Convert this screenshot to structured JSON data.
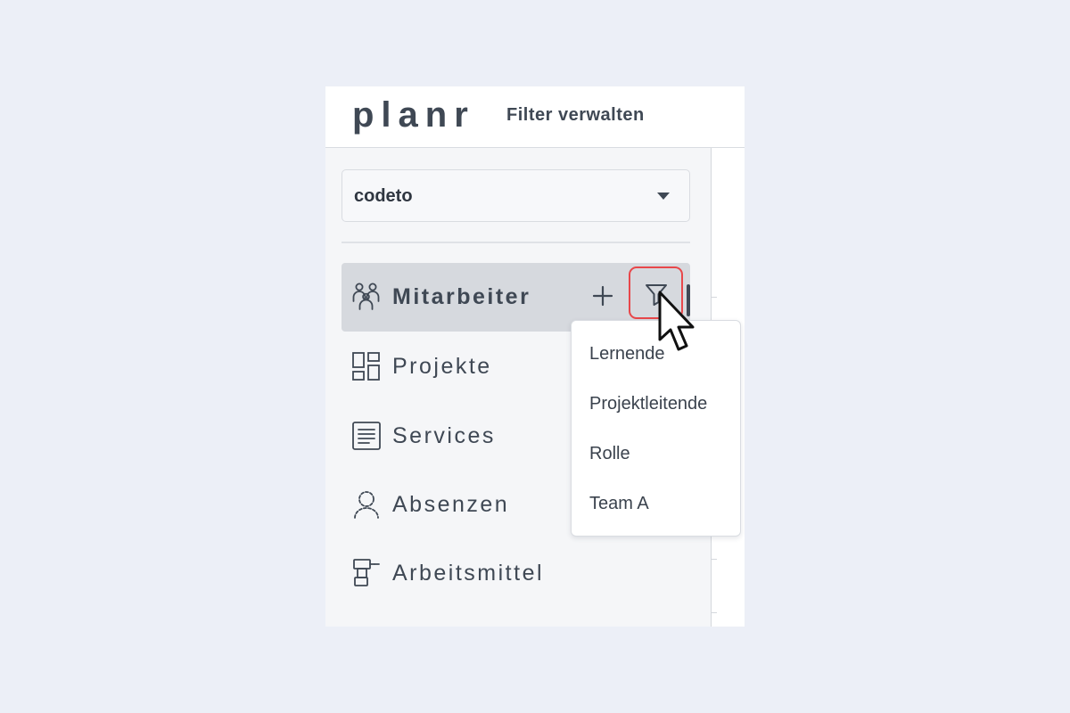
{
  "app": {
    "logo": "planr",
    "filter_manage": "Filter verwalten"
  },
  "org_select": {
    "value": "codeto"
  },
  "nav": {
    "items": [
      {
        "label": "Mitarbeiter",
        "icon": "users-icon",
        "active": true
      },
      {
        "label": "Projekte",
        "icon": "dashboard-icon",
        "active": false
      },
      {
        "label": "Services",
        "icon": "document-list-icon",
        "active": false
      },
      {
        "label": "Absenzen",
        "icon": "person-dashed-icon",
        "active": false
      },
      {
        "label": "Arbeitsmittel",
        "icon": "drill-icon",
        "active": false
      }
    ],
    "add_icon": "plus-icon",
    "filter_icon": "filter-icon"
  },
  "filter_dropdown": {
    "options": [
      "Lernende",
      "Projektleitende",
      "Rolle",
      "Team A"
    ]
  },
  "colors": {
    "background": "#eceff7",
    "sidebar": "#f5f6f8",
    "active_item": "#d6d9de",
    "text": "#3f4854",
    "highlight": "#e8474a"
  }
}
